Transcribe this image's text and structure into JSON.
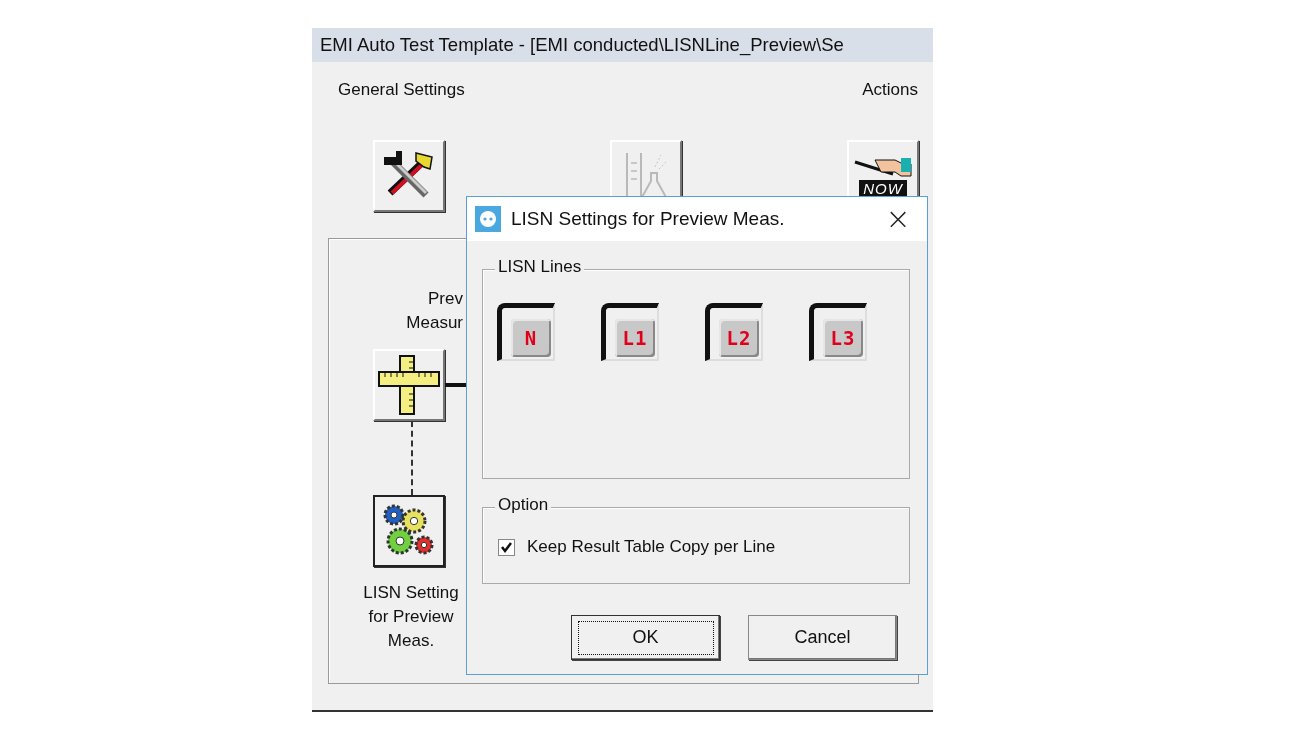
{
  "window": {
    "title": "EMI Auto Test Template - [EMI conducted\\LISNLine_Preview\\Se"
  },
  "header": {
    "left_label": "General Settings",
    "right_label": "Actions"
  },
  "toolbar": [
    {
      "kind": "tools",
      "disabled": false
    },
    {
      "kind": "lab",
      "disabled": true
    },
    {
      "kind": "now",
      "disabled": false,
      "caption": "NOW"
    }
  ],
  "flow": {
    "steps": [
      {
        "kind": "ruler",
        "label_lines": [
          "Prev",
          "Measur"
        ]
      },
      {
        "kind": "gears",
        "label_lines": [
          "LISN Setting",
          "for Preview",
          "Meas."
        ]
      }
    ]
  },
  "dialog": {
    "title": "LISN Settings for Preview Meas.",
    "close": "×",
    "lines_group": {
      "title": "LISN Lines",
      "lines": [
        {
          "label": "N",
          "selected": true
        },
        {
          "label": "L1",
          "selected": true
        },
        {
          "label": "L2",
          "selected": true
        },
        {
          "label": "L3",
          "selected": true
        }
      ]
    },
    "option_group": {
      "title": "Option",
      "checkbox": {
        "label": "Keep Result Table Copy per Line",
        "checked": true
      }
    },
    "buttons": [
      {
        "label": "OK",
        "default": true
      },
      {
        "label": "Cancel",
        "default": false
      }
    ]
  }
}
